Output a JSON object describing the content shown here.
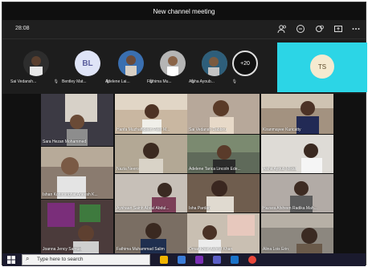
{
  "window": {
    "title": "New channel meeting"
  },
  "controls": {
    "timer": "28:08"
  },
  "strip": {
    "participants": [
      {
        "name": "Sai Vedansh...",
        "initials": "",
        "bg": "#2d2d2d"
      },
      {
        "name": "Bentley Mat...",
        "initials": "BL",
        "bg": "#dfe4f7"
      },
      {
        "name": "Adelene Lai...",
        "initials": "",
        "bg": "#6a4b3a"
      },
      {
        "name": "Fathima Mu...",
        "initials": "",
        "bg": "#b5b5b5"
      },
      {
        "name": "Aisha Ayoub...",
        "initials": "",
        "bg": "#6b7c6b"
      }
    ],
    "more_count": "+20",
    "shared_initials": "TS",
    "shared_bg": "#2cd5e6"
  },
  "grid": {
    "tiles": [
      {
        "name": "Sara Hezan Mohammed",
        "bg": "#3c3a44"
      },
      {
        "name": "Hanfa Muzhaffideen Peer M...",
        "bg": "#c9b7a1"
      },
      {
        "name": "Sai Vedansh Dabbiru",
        "bg": "#b7a89a"
      },
      {
        "name": "Kiranmayee Kuricatty",
        "bg": "#a39280"
      },
      {
        "name": "Nazia Neero",
        "bg": "#b3a895"
      },
      {
        "name": "Adelene Tarica Lincoln Ede...",
        "bg": "#5f6a5a"
      },
      {
        "name": "Aisha Ayoub Mikalt",
        "bg": "#dedbd6"
      },
      {
        "name": "Ishan Kottiroinghat Aneesh K...",
        "bg": "#8a7b6f"
      },
      {
        "name": "Ayshaan Sainh Abdul Abdul...",
        "bg": "#c7c0b8"
      },
      {
        "name": "Isha Pardan",
        "bg": "#6f5d4e"
      },
      {
        "name": "Hazara Afsheen Radika Mah...",
        "bg": "#b2aba6"
      },
      {
        "name": "Joanna Jency Samuel",
        "bg": "#4b3b3b"
      },
      {
        "name": "Fathima Muhammad Salim",
        "bg": "#7a6e63"
      },
      {
        "name": "Omar Khan Ashraf Khan",
        "bg": "#c9bfb2"
      },
      {
        "name": "Alina Lois Erin",
        "bg": "#8c877f"
      }
    ]
  },
  "taskbar": {
    "search_placeholder": "Type here to search"
  },
  "colors": {
    "accent": "#2cd5e6",
    "background": "#141414"
  }
}
